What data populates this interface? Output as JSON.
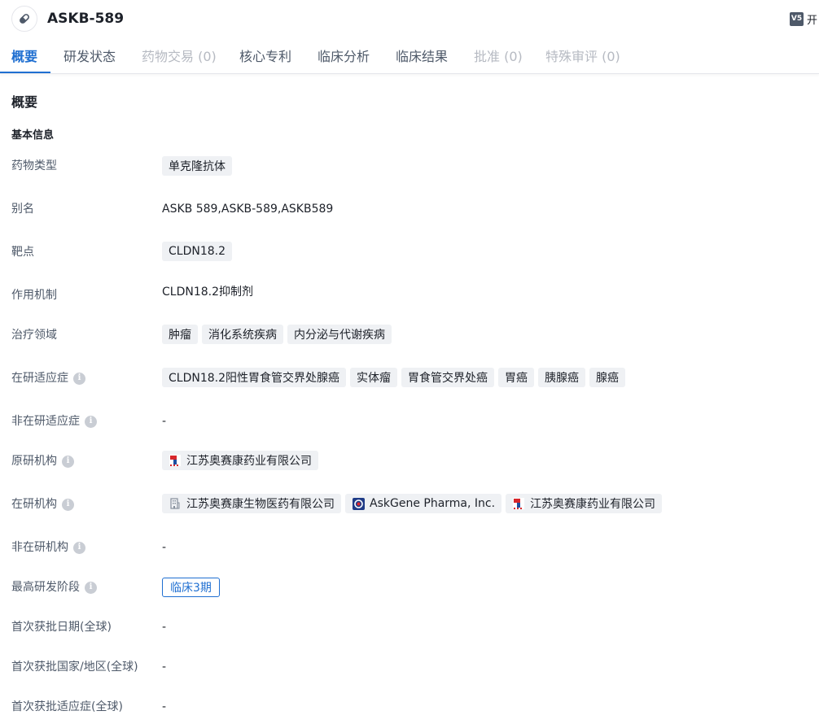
{
  "header": {
    "title": "ASKB-589",
    "version_badge": "V5",
    "version_label": "开"
  },
  "tabs": [
    {
      "label": "概要"
    },
    {
      "label": "研发状态"
    },
    {
      "label": "药物交易 (0)"
    },
    {
      "label": "核心专利"
    },
    {
      "label": "临床分析"
    },
    {
      "label": "临床结果"
    },
    {
      "label": "批准 (0)"
    },
    {
      "label": "特殊审评 (0)"
    }
  ],
  "overview": {
    "title": "概要",
    "basic_info_title": "基本信息",
    "info_icon_glyph": "i",
    "rows": {
      "drug_type": {
        "label": "药物类型",
        "tags": [
          "单克隆抗体"
        ]
      },
      "alias": {
        "label": "别名",
        "value": "ASKB 589,ASKB-589,ASKB589"
      },
      "target": {
        "label": "靶点",
        "tags": [
          "CLDN18.2"
        ]
      },
      "mechanism": {
        "label": "作用机制",
        "value": "CLDN18.2抑制剂"
      },
      "therapeutic_area": {
        "label": "治疗领域",
        "tags": [
          "肿瘤",
          "消化系统疾病",
          "内分泌与代谢疾病"
        ]
      },
      "active_indication": {
        "label": "在研适应症",
        "tags": [
          "CLDN18.2阳性胃食管交界处腺癌",
          "实体瘤",
          "胃食管交界处癌",
          "胃癌",
          "胰腺癌",
          "腺癌"
        ]
      },
      "inactive_indication": {
        "label": "非在研适应症",
        "value": "-"
      },
      "originator": {
        "label": "原研机构",
        "orgs": [
          {
            "name": "江苏奥赛康药业有限公司",
            "logo": "aosaikang-logo"
          }
        ]
      },
      "active_org": {
        "label": "在研机构",
        "orgs": [
          {
            "name": "江苏奥赛康生物医药有限公司",
            "logo": "building-icon"
          },
          {
            "name": "AskGene Pharma, Inc.",
            "logo": "askgene-logo"
          },
          {
            "name": "江苏奥赛康药业有限公司",
            "logo": "aosaikang-logo"
          }
        ]
      },
      "inactive_org": {
        "label": "非在研机构",
        "value": "-"
      },
      "highest_phase": {
        "label": "最高研发阶段",
        "tag": "临床3期"
      },
      "first_approval_date": {
        "label": "首次获批日期(全球)",
        "value": "-"
      },
      "first_approval_country": {
        "label": "首次获批国家/地区(全球)",
        "value": "-"
      },
      "first_approval_indication": {
        "label": "首次获批适应症(全球)",
        "value": "-"
      }
    }
  },
  "colors": {
    "accent": "#1f6fd1",
    "tag_bg": "#eff1f4",
    "label_text": "#4e5969",
    "disabled_text": "#b6bac2"
  }
}
